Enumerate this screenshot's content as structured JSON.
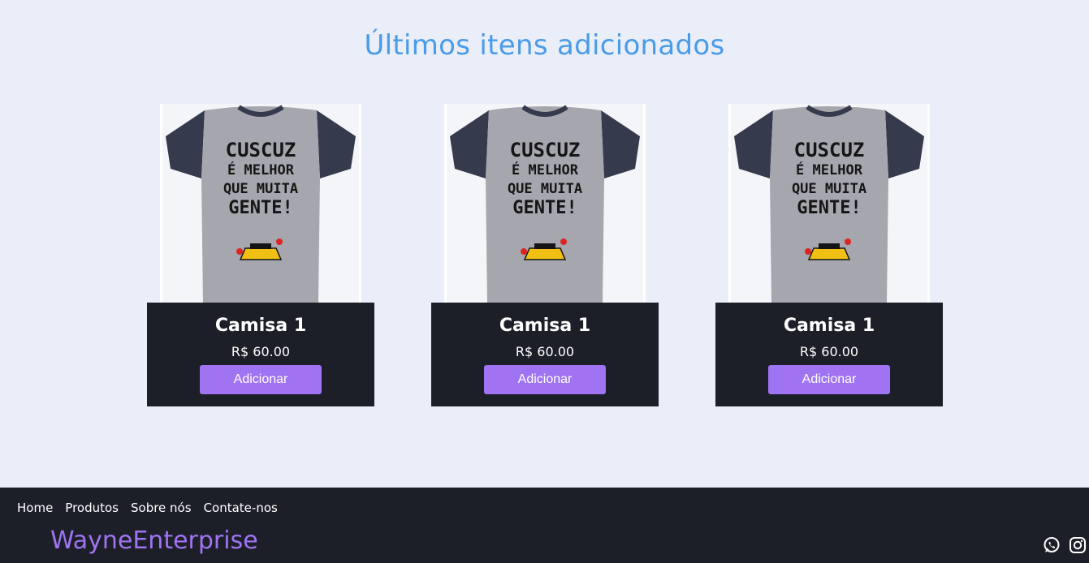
{
  "section": {
    "title": "Últimos itens adicionados"
  },
  "products": [
    {
      "image_text": [
        "CUSCUZ",
        "É MELHOR",
        "QUE MUITA",
        "GENTE!"
      ],
      "name": "Camisa 1",
      "price": "R$ 60.00",
      "button_label": "Adicionar"
    },
    {
      "image_text": [
        "CUSCUZ",
        "É MELHOR",
        "QUE MUITA",
        "GENTE!"
      ],
      "name": "Camisa 1",
      "price": "R$ 60.00",
      "button_label": "Adicionar"
    },
    {
      "image_text": [
        "CUSCUZ",
        "É MELHOR",
        "QUE MUITA",
        "GENTE!"
      ],
      "name": "Camisa 1",
      "price": "R$ 60.00",
      "button_label": "Adicionar"
    }
  ],
  "footer": {
    "nav": [
      "Home",
      "Produtos",
      "Sobre nós",
      "Contate-nos"
    ],
    "brand": "WayneEnterprise",
    "social_icons": [
      "whatsapp-icon",
      "instagram-icon"
    ]
  },
  "colors": {
    "background": "#eaeef8",
    "title": "#4a9be8",
    "dark": "#1c1f28",
    "accent": "#a073f2"
  }
}
